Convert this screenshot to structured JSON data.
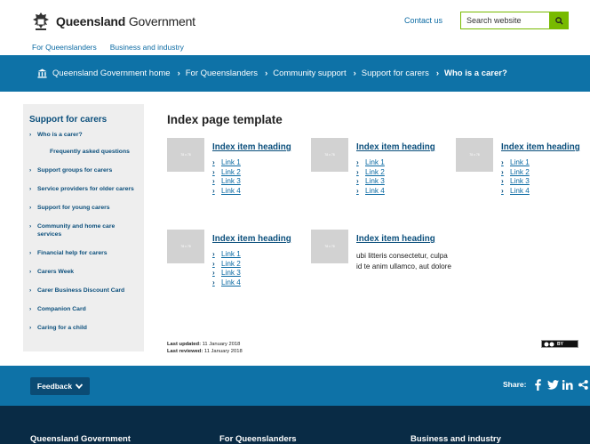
{
  "header": {
    "logo_bold": "Queensland",
    "logo_regular": " Government",
    "contact": "Contact us",
    "search_placeholder": "Search website"
  },
  "topnav": [
    "For Queenslanders",
    "Business and industry"
  ],
  "breadcrumb": {
    "home": "Queensland Government home",
    "items": [
      "For Queenslanders",
      "Community support",
      "Support for carers"
    ],
    "current": "Who is a carer?"
  },
  "sidebar": {
    "title": "Support for carers",
    "items": [
      "Who is a carer?",
      "Frequently asked questions",
      "Support groups for carers",
      "Service providers for older carers",
      "Support for young carers",
      "Community and home care services",
      "Financial help for carers",
      "Carers Week",
      "Carer Business Discount Card",
      "Companion Card",
      "Caring for a child"
    ]
  },
  "main": {
    "title": "Index page template",
    "thumb_label": "78 x 78",
    "cards": [
      {
        "heading": "Index item heading",
        "links": [
          "Link 1",
          "Link 2",
          "Link 3",
          "Link 4"
        ]
      },
      {
        "heading": "Index item heading",
        "links": [
          "Link 1",
          "Link 2",
          "Link 3",
          "Link 4"
        ]
      },
      {
        "heading": "Index item heading",
        "links": [
          "Link 1",
          "Link 2",
          "Link 3",
          "Link 4"
        ]
      },
      {
        "heading": "Index item heading",
        "links": [
          "Link 1",
          "Link 2",
          "Link 3",
          "Link 4"
        ]
      },
      {
        "heading": "Index item heading",
        "text": "ubi litteris consectetur, culpa id te anim ullamco, aut dolore"
      }
    ]
  },
  "dates": {
    "updated_label": "Last updated:",
    "updated": "11 January 2018",
    "reviewed_label": "Last reviewed:",
    "reviewed": "11 January 2018"
  },
  "license_badge": "BY",
  "footer": {
    "feedback": "Feedback",
    "share_label": "Share:",
    "columns": [
      "Queensland Government",
      "For Queenslanders",
      "Business and industry"
    ]
  },
  "colors": {
    "brand_blue": "#0e72a7",
    "navy": "#092b45",
    "link_dark": "#0b4f7c",
    "search_green": "#78ba00"
  }
}
